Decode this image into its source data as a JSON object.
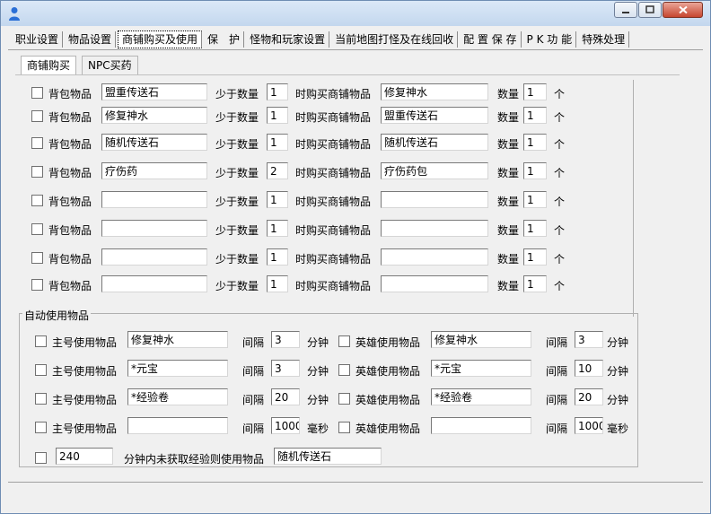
{
  "tabs": [
    "职业设置",
    "物品设置",
    "商铺购买及使用",
    "保　护",
    "怪物和玩家设置",
    "当前地图打怪及在线回收",
    "配 置 保 存",
    "P K 功 能",
    "特殊处理"
  ],
  "subtabs": [
    "商铺购买",
    "NPC买药"
  ],
  "purchase_labels": {
    "bag_item": "背包物品",
    "less_than": "少于数量",
    "buy_shop_item": "时购买商铺物品",
    "quantity": "数量",
    "unit": "个"
  },
  "purchase_rows": [
    {
      "bag": "盟重传送石",
      "min": "1",
      "shop": "修复神水",
      "qty": "1"
    },
    {
      "bag": "修复神水",
      "min": "1",
      "shop": "盟重传送石",
      "qty": "1"
    },
    {
      "bag": "随机传送石",
      "min": "1",
      "shop": "随机传送石",
      "qty": "1"
    },
    {
      "bag": "疗伤药",
      "min": "2",
      "shop": "疗伤药包",
      "qty": "1"
    },
    {
      "bag": "",
      "min": "1",
      "shop": "",
      "qty": "1"
    },
    {
      "bag": "",
      "min": "1",
      "shop": "",
      "qty": "1"
    },
    {
      "bag": "",
      "min": "1",
      "shop": "",
      "qty": "1"
    },
    {
      "bag": "",
      "min": "1",
      "shop": "",
      "qty": "1"
    }
  ],
  "auto_use": {
    "legend": "自动使用物品",
    "main_label": "主号使用物品",
    "hero_label": "英雄使用物品",
    "interval": "间隔",
    "rows": [
      {
        "main_item": "修复神水",
        "main_interval": "3",
        "main_unit": "分钟",
        "hero_item": "修复神水",
        "hero_interval": "3",
        "hero_unit": "分钟"
      },
      {
        "main_item": "*元宝",
        "main_interval": "3",
        "main_unit": "分钟",
        "hero_item": "*元宝",
        "hero_interval": "10",
        "hero_unit": "分钟"
      },
      {
        "main_item": "*经验卷",
        "main_interval": "20",
        "main_unit": "分钟",
        "hero_item": "*经验卷",
        "hero_interval": "20",
        "hero_unit": "分钟"
      },
      {
        "main_item": "",
        "main_interval": "1000",
        "main_unit": "毫秒",
        "hero_item": "",
        "hero_interval": "1000",
        "hero_unit": "毫秒"
      }
    ],
    "no_exp": {
      "minutes": "240",
      "label": "分钟内未获取经验则使用物品",
      "item": "随机传送石"
    }
  }
}
